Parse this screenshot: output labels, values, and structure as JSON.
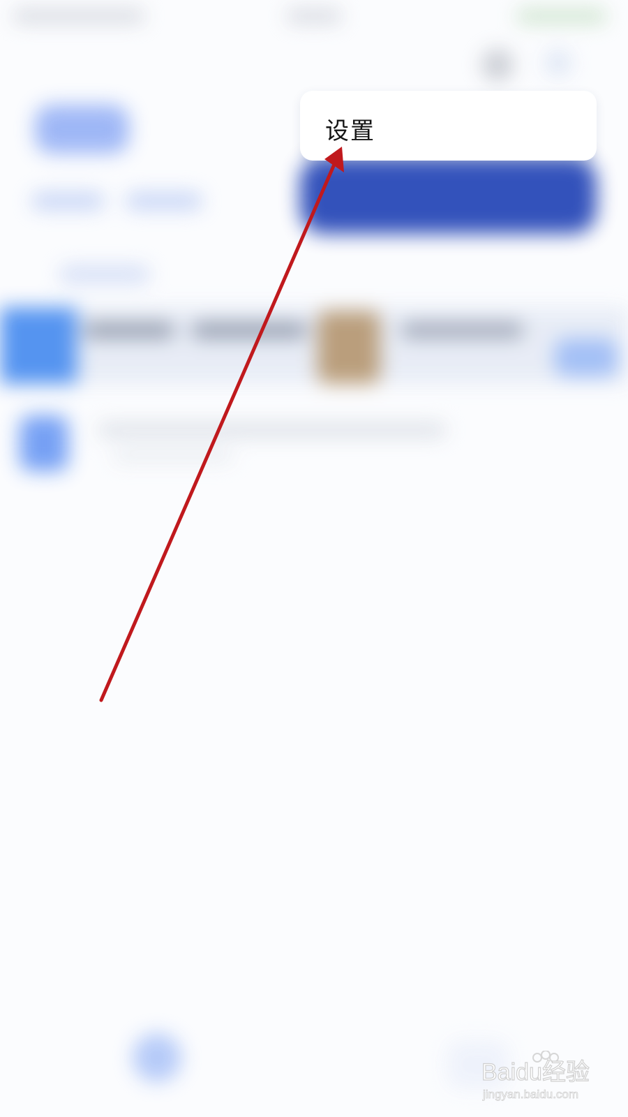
{
  "popup_menu": {
    "items": [
      {
        "label": "设置"
      }
    ]
  },
  "annotation": {
    "arrow_color": "#c0191d"
  },
  "watermark": {
    "brand": "Baidu经验",
    "url": "jingyan.baidu.com"
  },
  "colors": {
    "accent_blue": "#2949b8",
    "light_blue": "#9ab4f6"
  }
}
